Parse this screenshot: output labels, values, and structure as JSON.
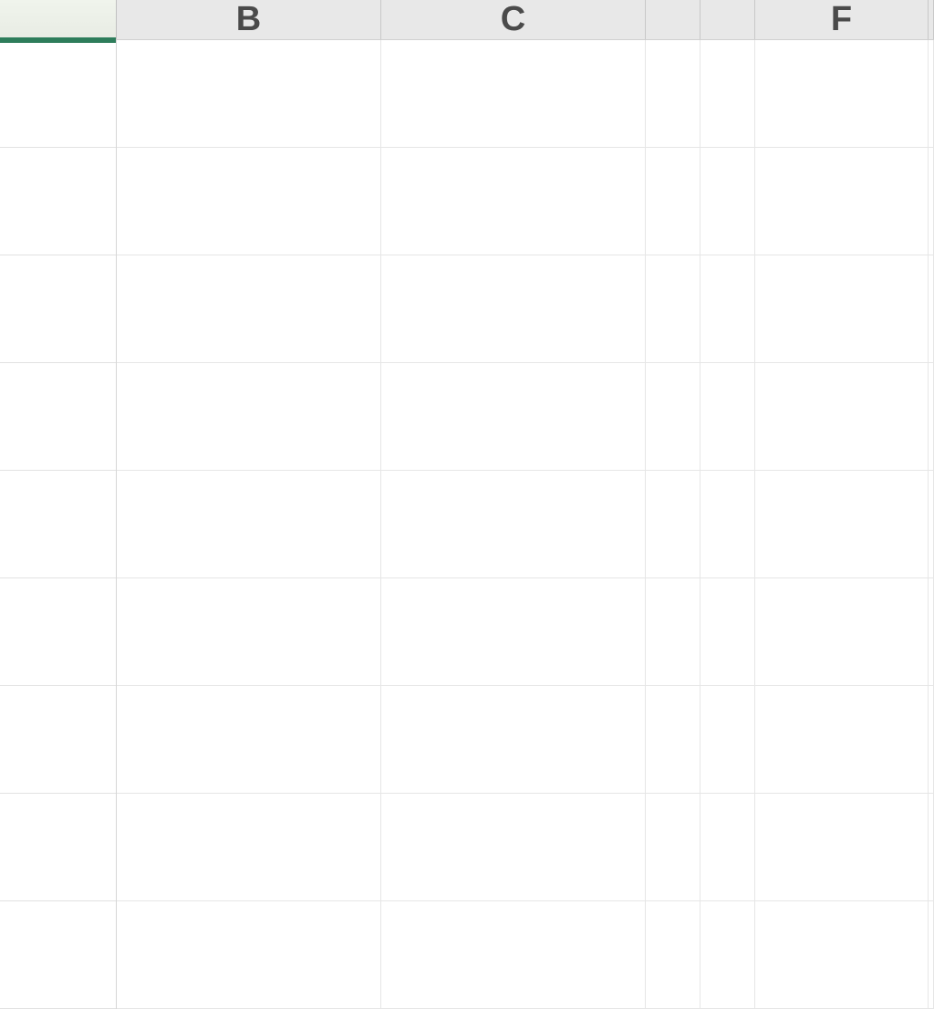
{
  "colors": {
    "selection_border": "#2e7d5b",
    "header_bg": "#e8e8e8",
    "grid_line": "#e6e6e6"
  },
  "columns": {
    "labels": [
      "",
      "B",
      "C",
      "",
      "",
      "F",
      ""
    ]
  },
  "rows": {
    "count": 9
  },
  "active_cell": "A1"
}
